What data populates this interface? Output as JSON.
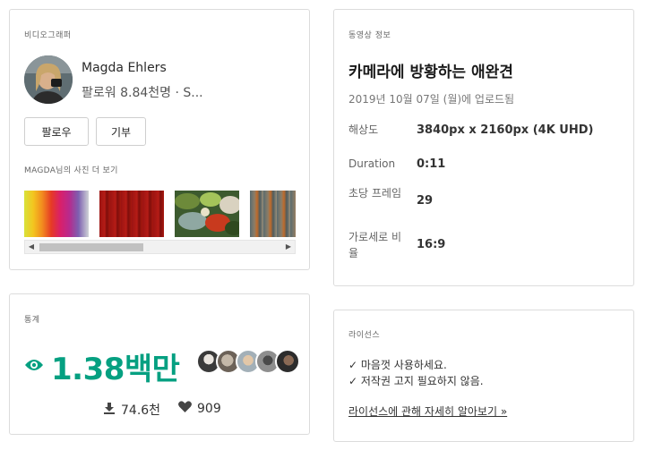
{
  "videographer": {
    "section_label": "비디오그래퍼",
    "name": "Magda Ehlers",
    "subline": "팔로워 8.84천명 · S...",
    "follow_label": "팔로우",
    "donate_label": "기부",
    "more_label": "MAGDA님의 사진 더 보기"
  },
  "stats": {
    "section_label": "통계",
    "views": "1.38백만",
    "downloads": "74.6천",
    "likes": "909"
  },
  "video": {
    "section_label": "동영상 정보",
    "title": "카메라에 방황하는 애완견",
    "upload_date": "2019년 10월 07일 (월)에 업로드됨",
    "specs": [
      {
        "key": "해상도",
        "value": "3840px x 2160px (4K UHD)"
      },
      {
        "key": "Duration",
        "value": "0:11"
      },
      {
        "key": "초당 프레임",
        "value": "29"
      },
      {
        "key": "가로세로 비율",
        "value": "16:9"
      }
    ]
  },
  "license": {
    "section_label": "라이선스",
    "lines": [
      "✓ 마음껏 사용하세요.",
      "✓ 저작권 고지 필요하지 않음."
    ],
    "link": "라이선스에 관해 자세히 알아보기 »"
  },
  "colors": {
    "accent": "#05a081",
    "border": "#dcdcdc"
  }
}
